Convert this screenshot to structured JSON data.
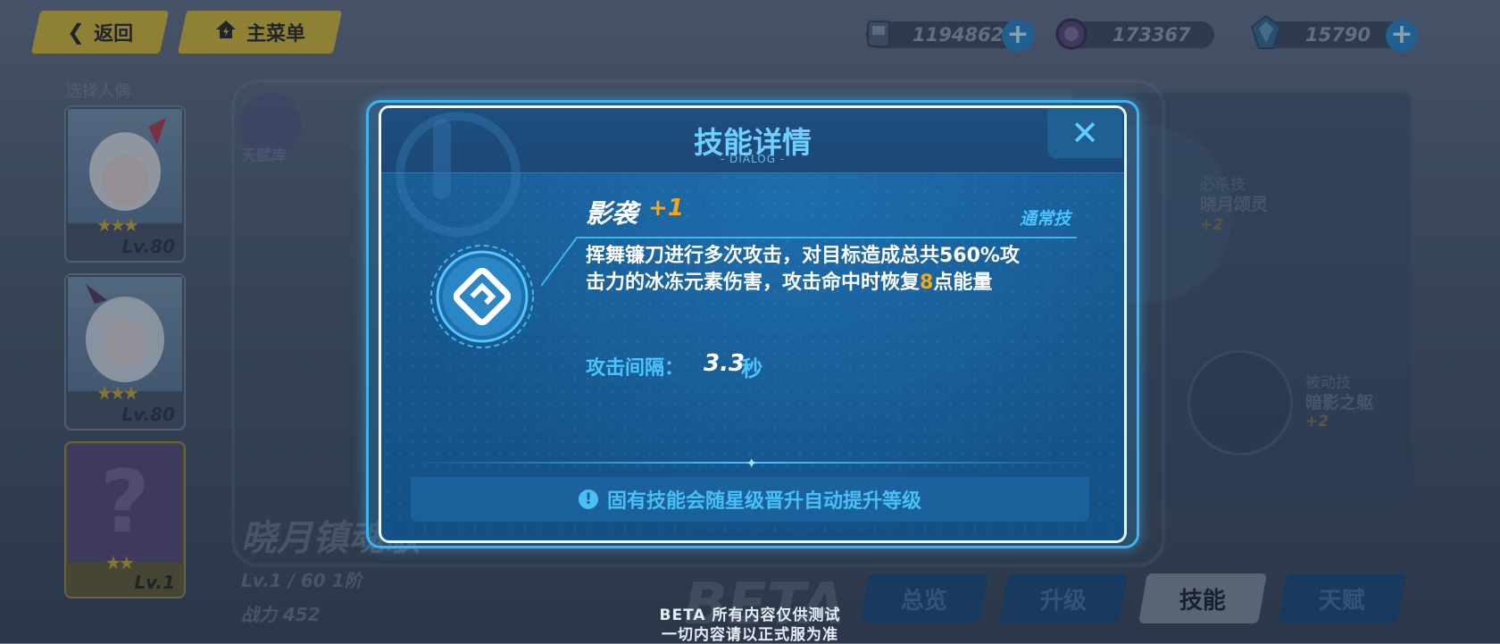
{
  "topbar": {
    "back_label": "返回",
    "menu_label": "主菜单",
    "currencies": [
      {
        "icon": "gamepad-coin-icon",
        "value": "1194862"
      },
      {
        "icon": "purple-crystal-icon",
        "value": "173367"
      },
      {
        "icon": "blue-crystal-icon",
        "value": "15790"
      }
    ]
  },
  "left_panel": {
    "title": "选择人偶",
    "cards": [
      {
        "level": "Lv.80",
        "stars": "★★★"
      },
      {
        "level": "Lv.80",
        "stars": "★★★"
      },
      {
        "level": "Lv.1",
        "stars": "★★",
        "unknown": "?"
      }
    ]
  },
  "background": {
    "talent_label": "天赋库",
    "character_name": "晓月镇魂歌",
    "level_info": "Lv.1 / 60  1阶",
    "power": "战力 452",
    "right_skills": [
      {
        "type": "必杀技",
        "name": "晓月颂灵",
        "level": "+2"
      },
      {
        "type": "被动技",
        "name": "暗影之躯",
        "level": "+2"
      }
    ],
    "beta_watermark": "BETA"
  },
  "tabs": [
    {
      "label": "总览",
      "active": false
    },
    {
      "label": "升级",
      "active": false
    },
    {
      "label": "技能",
      "active": true
    },
    {
      "label": "天赋",
      "active": false
    }
  ],
  "dialog": {
    "title": "技能详情",
    "subtitle": "- DIALOG -",
    "close": "✕",
    "skill": {
      "name": "影袭",
      "plus": "+1",
      "type": "通常技",
      "desc_1": "挥舞镰刀进行多次攻击，对目标造成总共560%攻",
      "desc_2a": "击力的冰冻元素伤害，攻击命中时恢复",
      "desc_2b": "8",
      "desc_2c": "点能量",
      "interval_label": "攻击间隔：",
      "interval_value": "3.3",
      "interval_unit": "秒"
    },
    "notice": "固有技能会随星级晋升自动提升等级"
  },
  "footer": {
    "line1": "BETA 所有内容仅供测试",
    "line2": "一切内容请以正式服为准"
  },
  "colors": {
    "accent": "#4cc4ff",
    "highlight": "#f3a71c",
    "button_yellow": "#e7c93b"
  }
}
